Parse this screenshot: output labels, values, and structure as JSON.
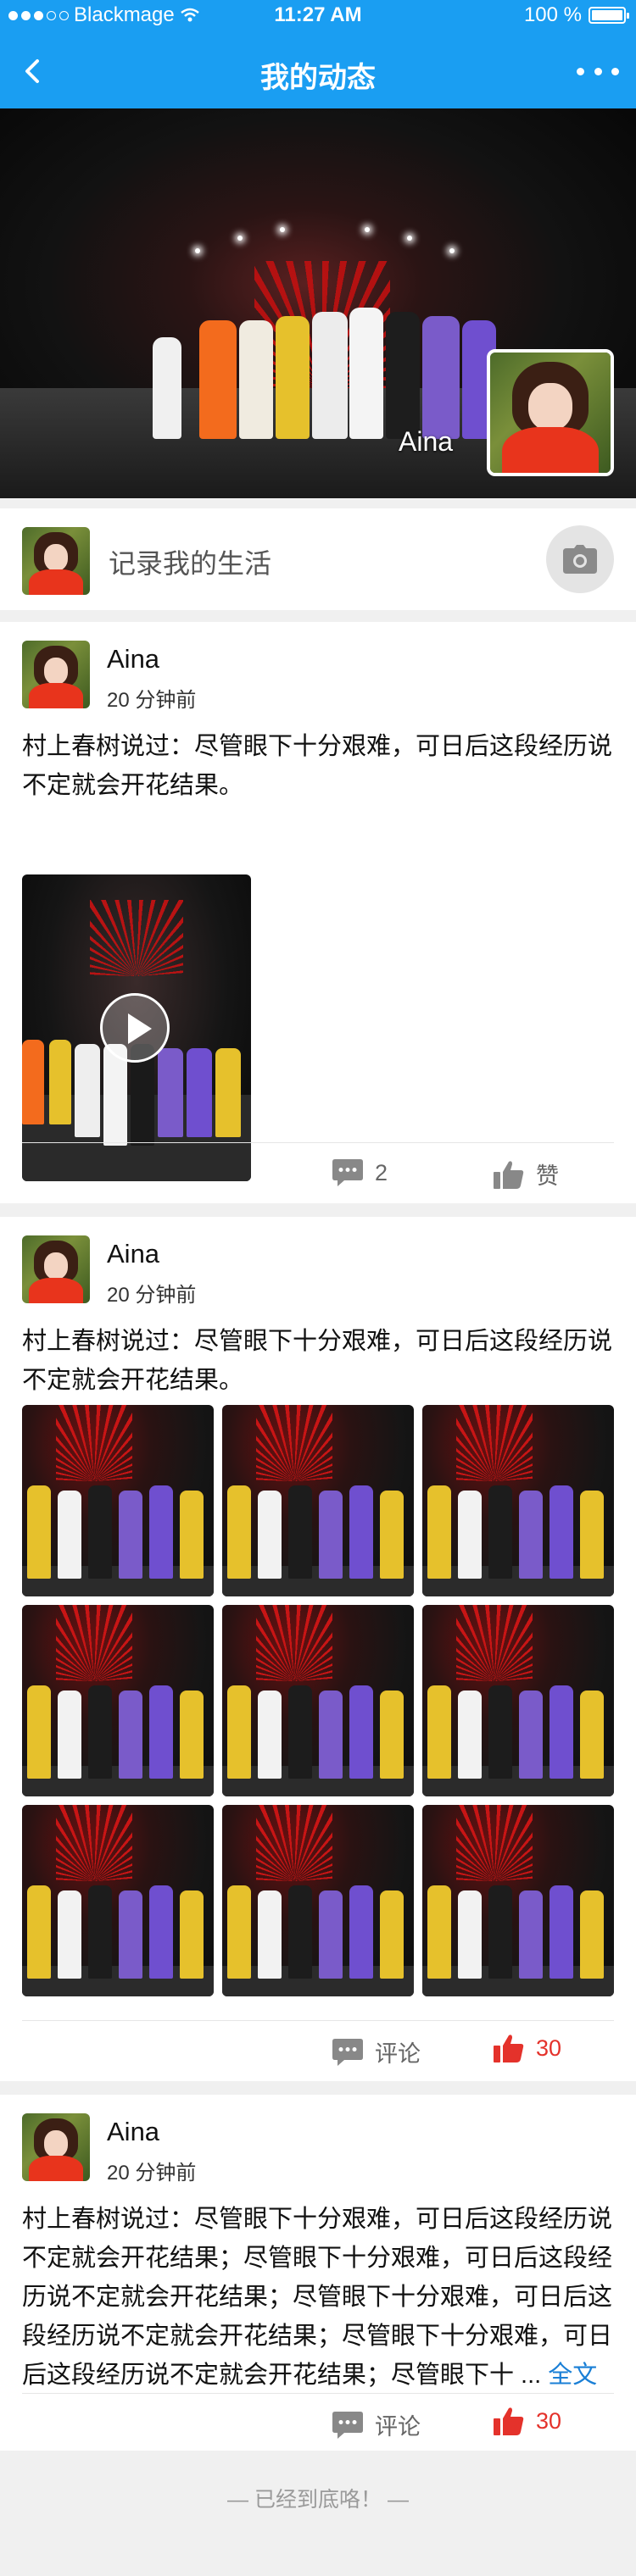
{
  "status_bar": {
    "carrier": "Blackmage",
    "time": "11:27 AM",
    "battery_text": "100 %",
    "battery_level": 1.0
  },
  "nav": {
    "title": "我的动态"
  },
  "cover": {
    "name": "Aina"
  },
  "composer": {
    "placeholder": "记录我的生活"
  },
  "posts": [
    {
      "user": "Aina",
      "time": "20 分钟前",
      "text": "村上春树说过：尽管眼下十分艰难，可日后这段经历说不定就会开花结果。",
      "media": "video",
      "comment_label": "2",
      "like_label": "赞",
      "liked": false
    },
    {
      "user": "Aina",
      "time": "20 分钟前",
      "text": "村上春树说过：尽管眼下十分艰难，可日后这段经历说不定就会开花结果。",
      "media": "photos",
      "photo_count": 9,
      "comment_label": "评论",
      "like_label": "30",
      "liked": true
    },
    {
      "user": "Aina",
      "time": "20 分钟前",
      "text": "村上春树说过：尽管眼下十分艰难，可日后这段经历说不定就会开花结果；尽管眼下十分艰难，可日后这段经历说不定就会开花结果；尽管眼下十分艰难，可日后这段经历说不定就会开花结果；尽管眼下十分艰难，可日后这段经历说不定就会开花结果；尽管眼下十 ...",
      "more_label": "全文",
      "comment_label": "评论",
      "like_label": "30",
      "liked": true
    }
  ],
  "footer": {
    "end_text": "— 已经到底咯！ —"
  },
  "colors": {
    "brand": "#1a9ef2",
    "like_red": "#e4322b",
    "link_blue": "#1a7fd6"
  }
}
